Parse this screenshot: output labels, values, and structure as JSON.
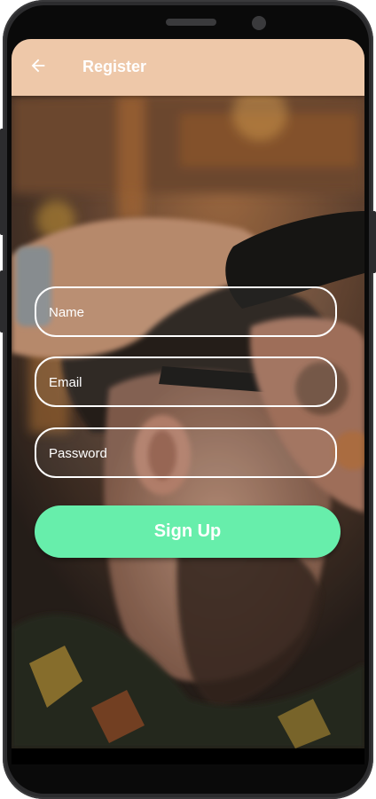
{
  "appbar": {
    "title": "Register",
    "back_icon": "arrow-left-icon",
    "background": "#eec8a9"
  },
  "form": {
    "name_placeholder": "Name",
    "email_placeholder": "Email",
    "password_placeholder": "Password",
    "signup_label": "Sign Up",
    "button_color": "#67eeab"
  },
  "background_image": "barber-cutting-hair-photo"
}
